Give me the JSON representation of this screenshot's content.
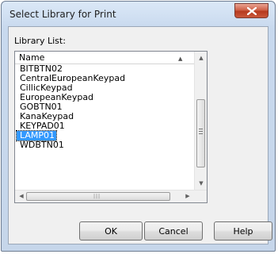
{
  "window": {
    "title": "Select Library for Print"
  },
  "library": {
    "label": "Library List:",
    "column_header": "Name",
    "items": [
      "BITBTN02",
      "CentralEuropeanKeypad",
      "CillicKeypad",
      "EuropeanKeypad",
      "GOBTN01",
      "KanaKeypad",
      "KEYPAD01",
      "LAMP01",
      "WDBTN01"
    ],
    "selected": "LAMP01"
  },
  "buttons": {
    "ok": "OK",
    "cancel": "Cancel",
    "help": "Help"
  },
  "icons": {
    "close": "close-icon",
    "sort": "sort-up-arrow-icon",
    "scroll_up": "scroll-up-arrow-icon",
    "scroll_down": "scroll-down-arrow-icon",
    "scroll_left": "scroll-left-arrow-icon",
    "scroll_right": "scroll-right-arrow-icon"
  },
  "colors": {
    "selection": "#3399ff",
    "close_button": "#c94f34"
  }
}
